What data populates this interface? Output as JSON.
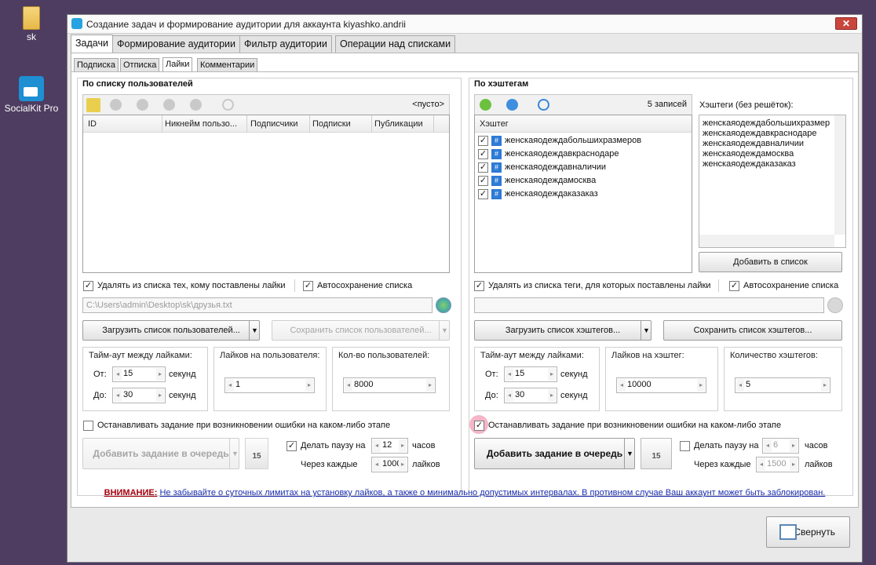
{
  "desktop": {
    "icon1": "sk",
    "icon2": "SocialKit Pro"
  },
  "window": {
    "title": "Создание задач и формирование аудитории для аккаунта kiyashko.andrii",
    "close": "✕"
  },
  "main_tabs": [
    "Задачи",
    "Формирование аудитории",
    "Фильтр аудитории",
    "Операции над списками"
  ],
  "sub_tabs": [
    "Подписка",
    "Отписка",
    "Лайки",
    "Комментарии"
  ],
  "left": {
    "title": "По списку пользователей",
    "empty": "<пусто>",
    "columns": [
      "ID",
      "Никнейм пользо...",
      "Подписчики",
      "Подписки",
      "Публикации"
    ],
    "chk_remove": "Удалять из списка тех, кому поставлены лайки",
    "chk_autosave": "Автосохранение списка",
    "path": "C:\\Users\\admin\\Desktop\\sk\\друзья.txt",
    "load_btn": "Загрузить список пользователей...",
    "save_btn": "Сохранить список пользователей...",
    "timeout_title": "Тайм-аут между лайками:",
    "from": "От:",
    "to": "До:",
    "sec": "секунд",
    "from_val": "15",
    "to_val": "30",
    "likes_title": "Лайков на пользователя:",
    "likes_val": "1",
    "count_title": "Кол-во пользователей:",
    "count_val": "8000",
    "stop_chk": "Останавливать задание при возникновении ошибки на каком-либо этапе",
    "add_btn": "Добавить задание в очередь",
    "cal": "15",
    "pause_chk": "Делать паузу на",
    "pause_val": "12",
    "hours": "часов",
    "every": "Через каждые",
    "every_val": "1000",
    "likes": "лайков"
  },
  "right": {
    "title": "По хэштегам",
    "count": "5 записей",
    "col": "Хэштег",
    "tags": [
      "женскаяодеждабольшихразмеров",
      "женскаяодеждавкраснодаре",
      "женскаяодеждавналичии",
      "женскаяодеждамосква",
      "женскаяодеждаказаказ"
    ],
    "tags_label": "Хэштеги (без решёток):",
    "text_lines": [
      "женскаяодеждабольшихразмер",
      "женскаяодеждавкраснодаре",
      "женскаяодеждавналичии",
      "женскаяодеждамосква",
      "женскаяодеждаказаказ"
    ],
    "add_list": "Добавить в список",
    "chk_remove": "Удалять из списка теги, для которых поставлены лайки",
    "chk_autosave": "Автосохранение списка",
    "load_btn": "Загрузить список хэштегов...",
    "save_btn": "Сохранить список хэштегов...",
    "timeout_title": "Тайм-аут между лайками:",
    "from": "От:",
    "to": "До:",
    "sec": "секунд",
    "from_val": "15",
    "to_val": "30",
    "likes_title": "Лайков на хэштег:",
    "likes_val": "10000",
    "count_title": "Количество хэштегов:",
    "count_val": "5",
    "stop_chk": "Останавливать задание при возникновении ошибки на каком-либо этапе",
    "add_btn": "Добавить задание в очередь",
    "cal": "15",
    "pause_chk": "Делать паузу на",
    "pause_val": "6",
    "hours": "часов",
    "every": "Через каждые",
    "every_val": "1500",
    "likes": "лайков"
  },
  "warning": {
    "label": "ВНИМАНИЕ:",
    "text": "Не забывайте о суточных лимитах на установку лайков, а также о минимально допустимых интервалах. В противном случае Ваш аккаунт может быть заблокирован."
  },
  "minimize": "Свернуть"
}
